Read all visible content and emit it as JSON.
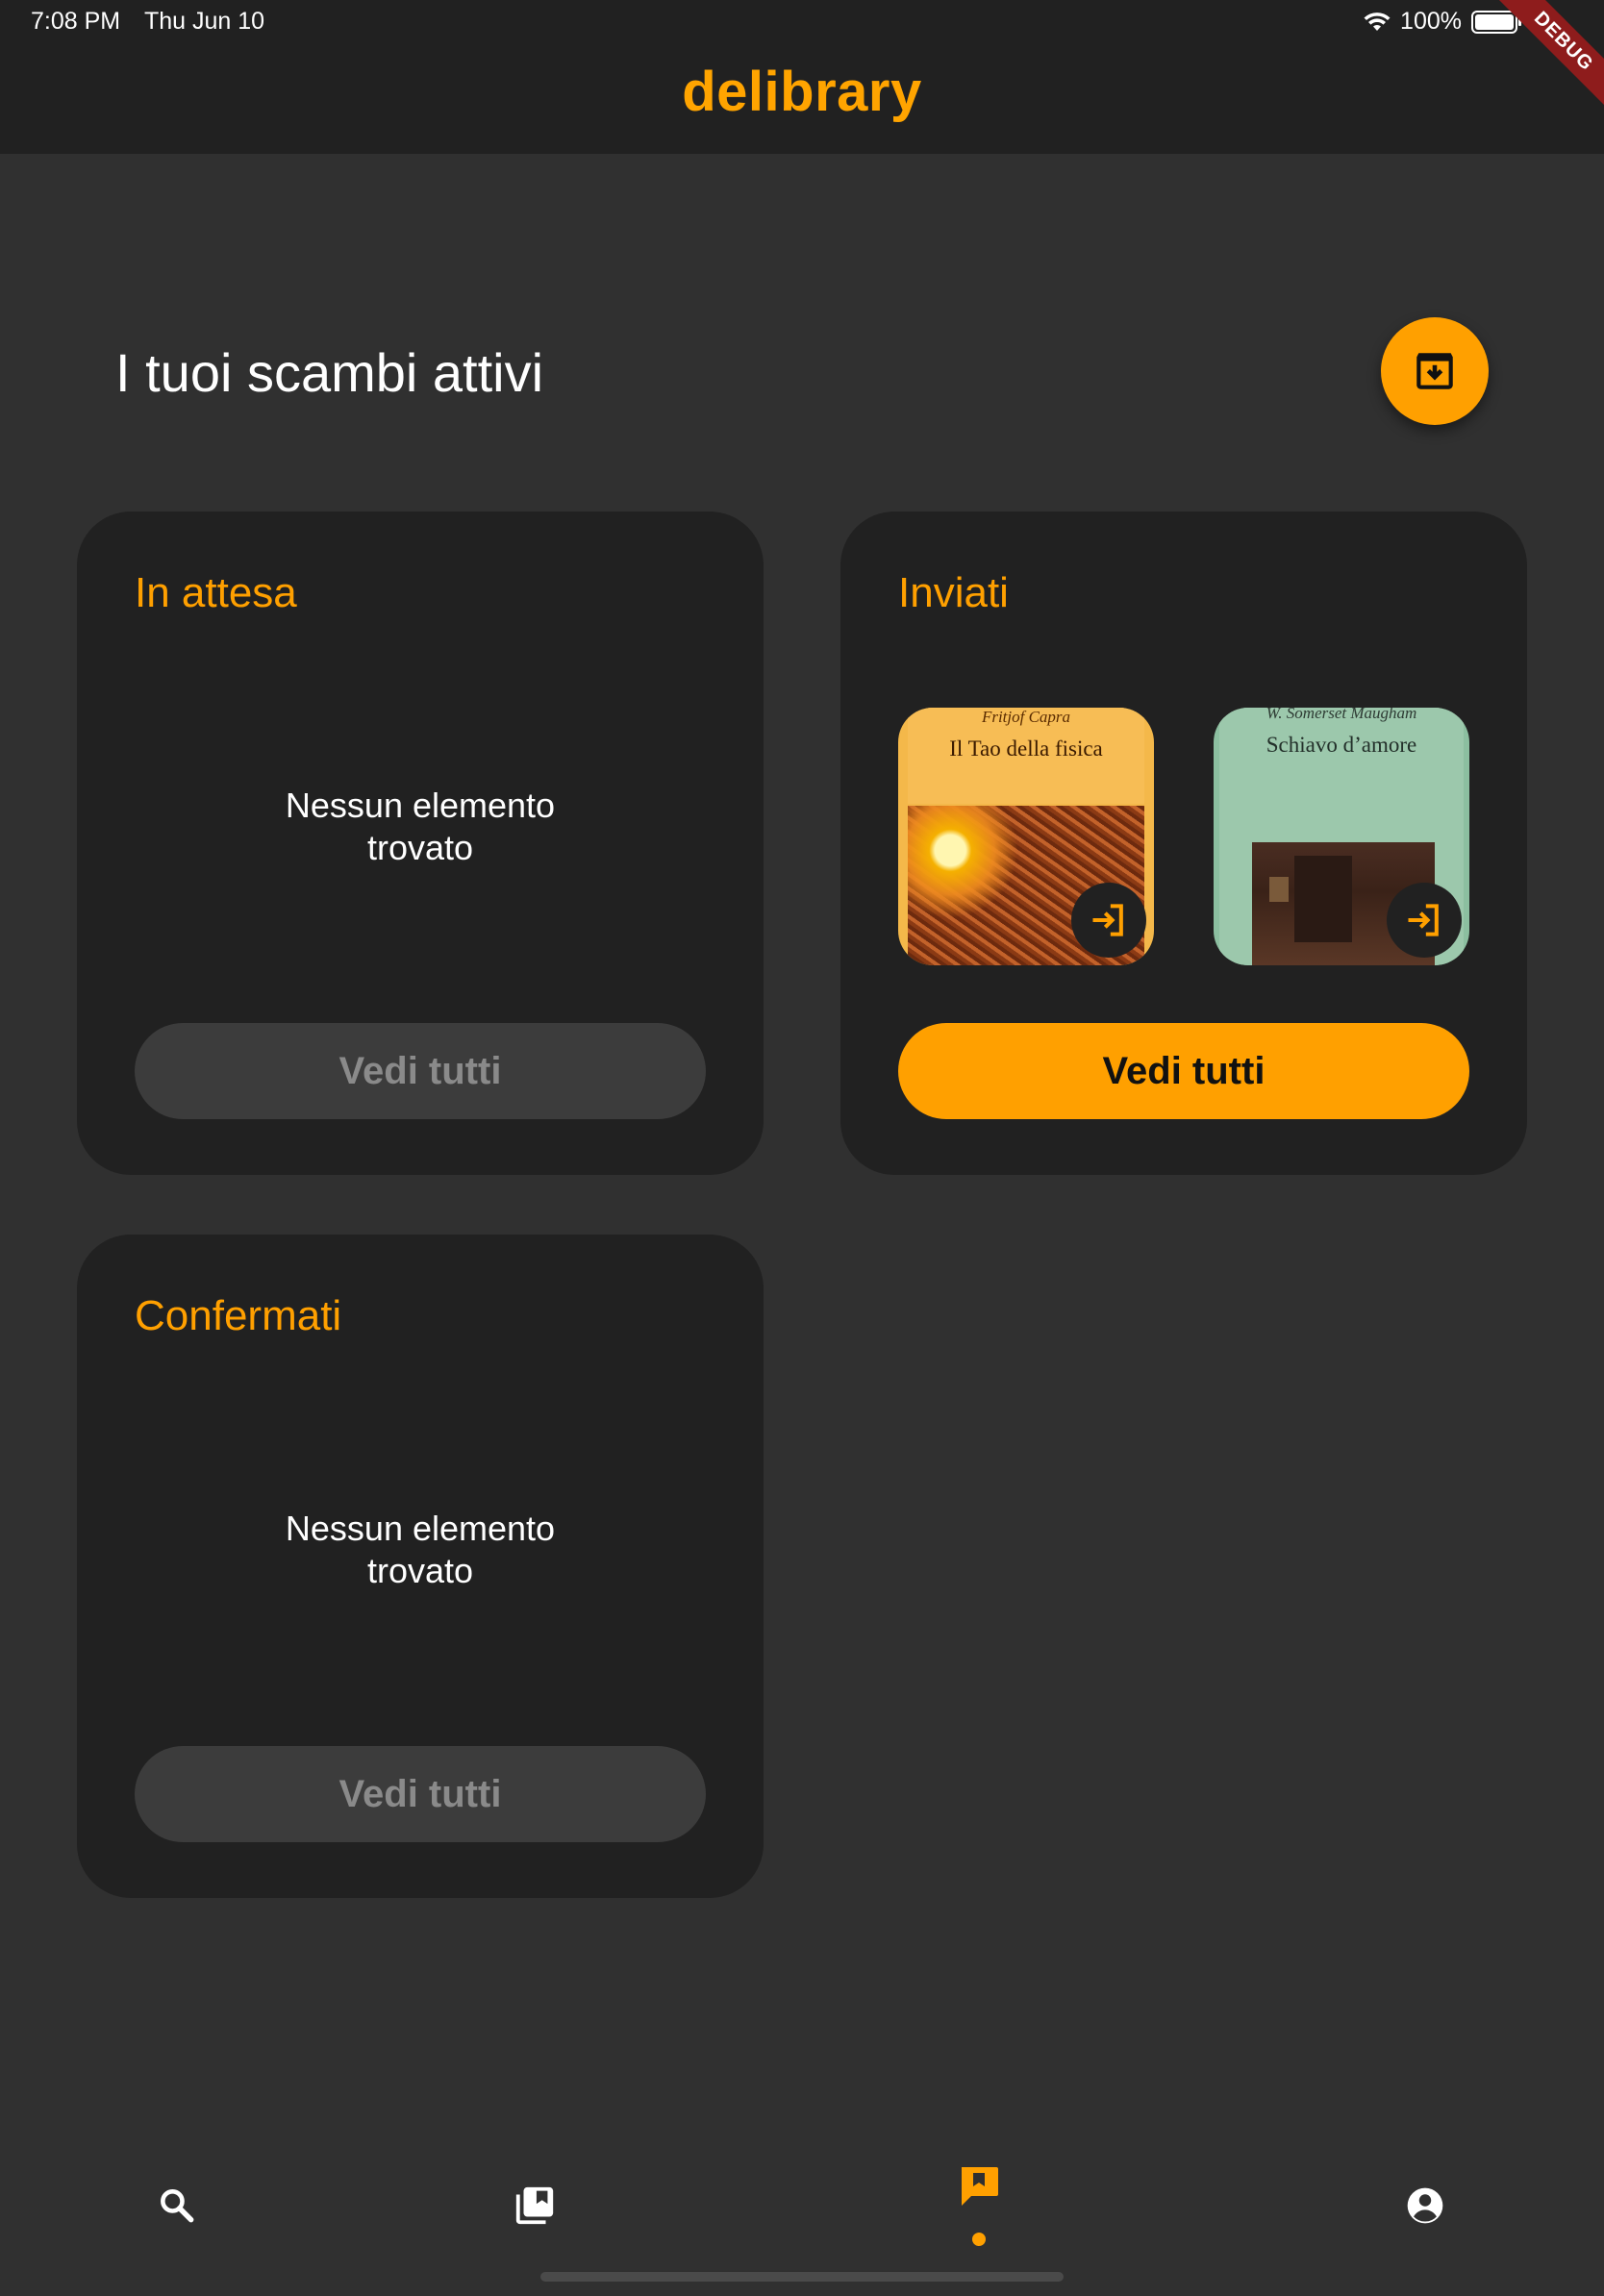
{
  "status_bar": {
    "time": "7:08 PM",
    "date": "Thu Jun 10",
    "battery_percent": "100%",
    "battery_level": 1.0
  },
  "debug_banner": "DEBUG",
  "app_bar": {
    "title": "delibrary"
  },
  "page": {
    "title": "I tuoi scambi attivi",
    "archive_button_icon": "archive-download-icon"
  },
  "cards": {
    "pending": {
      "title": "In attesa",
      "empty_text": "Nessun elemento trovato",
      "button_label": "Vedi tutti"
    },
    "sent": {
      "title": "Inviati",
      "books": [
        {
          "author": "Fritjof Capra",
          "title": "Il Tao della fisica"
        },
        {
          "author": "W. Somerset Maugham",
          "title": "Schiavo d’amore"
        }
      ],
      "button_label": "Vedi tutti"
    },
    "confirmed": {
      "title": "Confermati",
      "empty_text": "Nessun elemento trovato",
      "button_label": "Vedi tutti"
    }
  },
  "bottom_nav": {
    "items": [
      {
        "icon": "search-icon"
      },
      {
        "icon": "library-books-icon"
      },
      {
        "icon": "exchange-flag-icon",
        "active": true
      },
      {
        "icon": "account-circle-icon"
      }
    ]
  },
  "colors": {
    "accent": "#ffa000",
    "background": "#303030",
    "card": "#212121",
    "app_bar": "#212121"
  }
}
